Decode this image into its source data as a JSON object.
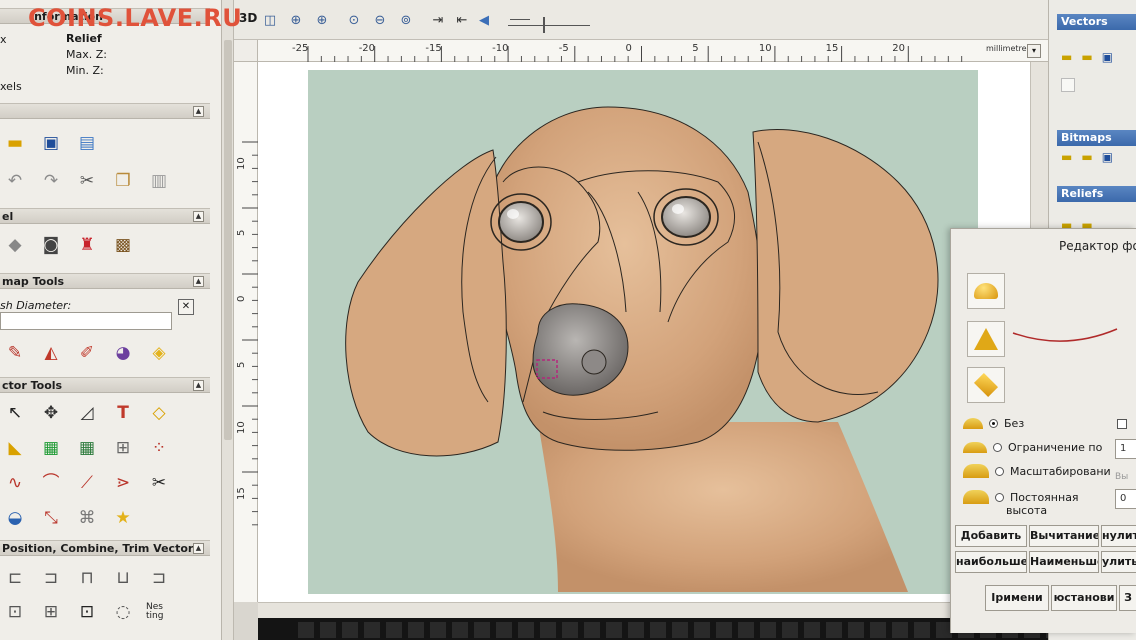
{
  "watermark": "COINS.LAVE.RU",
  "left_panel": {
    "info_header": "Information",
    "relief_label": "Relief",
    "max_z_label": "Max. Z:",
    "min_z_label": "Min. Z:",
    "pixels_label": "xels",
    "x_label": "x",
    "model_header": "el",
    "bitmap_header": "map Tools",
    "brush_label": "sh Diameter:",
    "vector_header": "ctor Tools",
    "pos_header": "Position, Combine, Trim Vectors",
    "nesting_label": "Nes ting"
  },
  "toolbar": {
    "btn_3d": "3D"
  },
  "ruler": {
    "units": "millimetres",
    "h_ticks": [
      "-25",
      "-20",
      "-15",
      "-10",
      "-5",
      "0",
      "5",
      "10",
      "15",
      "20"
    ],
    "v_ticks": [
      "10",
      "5",
      "0",
      "5",
      "10",
      "15"
    ]
  },
  "right_panel": {
    "vectors_header": "Vectors",
    "bitmaps_header": "Bitmaps",
    "reliefs_header": "Reliefs"
  },
  "editor": {
    "title": "Редактор фо",
    "opt_none": "Без",
    "opt_limit": "Ограничение по",
    "opt_scale": "Масштабировани",
    "opt_const": "Постоянная",
    "opt_const2": "высота",
    "limit_value": "1",
    "const_value": "0",
    "side_label": "Вы",
    "add_btn": "Добавить",
    "subtract_btn": "Вычитание",
    "zero_btn": "нулить",
    "highest_btn": "наибольше",
    "lowest_btn": "Наименьше",
    "mult_btn": "улить",
    "apply_btn": "Iримени",
    "reset_btn": "юстанови",
    "z_btn": "З"
  },
  "colors": {
    "canvas_bg": "#b9cfc1",
    "dog": "#d8a87c",
    "outline": "#2b2620",
    "panel_head_blue": "#3b69ab",
    "watermark": "#e0523a"
  }
}
